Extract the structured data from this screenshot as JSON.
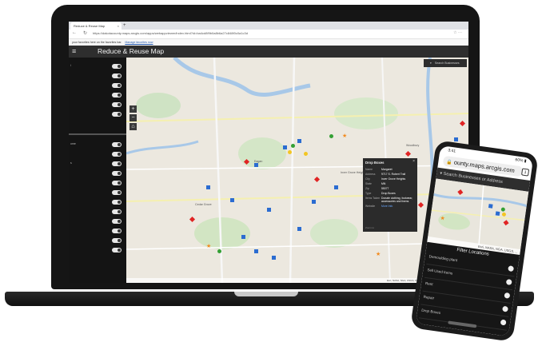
{
  "browser": {
    "tab_title": "Reduce & Reuse Map",
    "tab_close": "×",
    "new_tab": "+",
    "back": "←",
    "refresh": "↻",
    "url": "https://dakotacounty.maps.arcgis.com/apps/webappviewer/index.html?id=ba4cd8f9b0a8b6a27c848f0c0a1c3d",
    "favorites_text": "your favorites here on the favorites bar.",
    "favorites_link": "Manage favorites now",
    "toolbar_icons": "☆  ⋯"
  },
  "app": {
    "menu_icon": "≡",
    "title": "Reduce & Reuse Map"
  },
  "sidebar": {
    "group1": [
      {
        "label": "i"
      },
      {
        "label": ""
      },
      {
        "label": ""
      },
      {
        "label": ""
      },
      {
        "label": ""
      },
      {
        "label": ""
      }
    ],
    "group2": [
      {
        "label": "ome"
      },
      {
        "label": ""
      },
      {
        "label": "s"
      },
      {
        "label": ""
      },
      {
        "label": ""
      },
      {
        "label": ""
      },
      {
        "label": ""
      },
      {
        "label": ""
      },
      {
        "label": ""
      },
      {
        "label": ""
      },
      {
        "label": ""
      },
      {
        "label": ""
      }
    ]
  },
  "map": {
    "zoom_in": "+",
    "zoom_out": "−",
    "home": "⌂",
    "search_placeholder": "Search Businesses",
    "labels": {
      "eagan": "Eagan",
      "inver_grove": "Inver Grove Heights",
      "cedar_grove": "Cedar Grove",
      "new_market": "Woodbury"
    },
    "attribution": "Esri, NASA, NGA, USGS, FEMA | County of Dakota, Metropolitan Council"
  },
  "popup": {
    "title": "Drop Boxes",
    "close": "×",
    "fields": [
      {
        "k": "Name",
        "v": "Margaret"
      },
      {
        "k": "Address",
        "v": "9717 S. Robert Trail"
      },
      {
        "k": "City",
        "v": "Inver Grove Heights"
      },
      {
        "k": "State",
        "v": "MN"
      },
      {
        "k": "Zip",
        "v": "55077"
      },
      {
        "k": "Type",
        "v": "Drop Boxes"
      },
      {
        "k": "Items Taken",
        "v": "Donate clothing, footwear, accessories and linens"
      },
      {
        "k": "Website",
        "v": "More Info"
      }
    ],
    "footer": "Zoom to"
  },
  "phone": {
    "time": "3:41",
    "battery": "60% ▮",
    "url": "ounty.maps.arcgis.com",
    "tabs_count": "1",
    "search_placeholder": "Search Businesses or Address",
    "map_attribution": "Esri, NASA, NGA, USGS, ...",
    "panel_title": "Filter Locations",
    "rows": [
      {
        "label": "Demoulding plant"
      },
      {
        "label": "Sell Used Items"
      },
      {
        "label": "Rent"
      },
      {
        "label": "Repair"
      },
      {
        "label": "Drop Boxes"
      }
    ]
  }
}
